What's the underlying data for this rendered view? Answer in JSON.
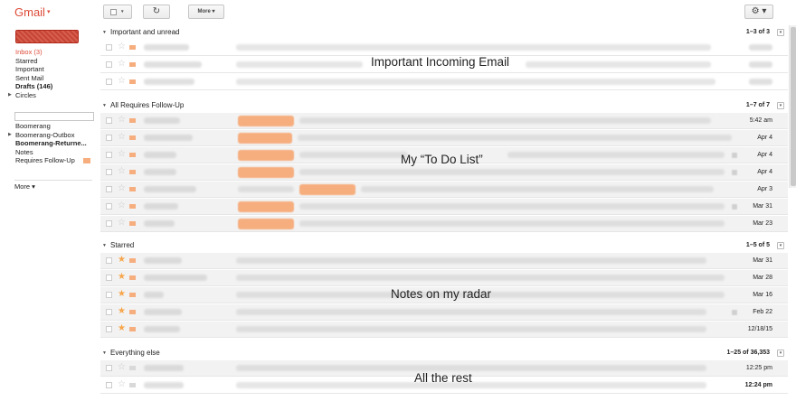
{
  "app": {
    "logo": "Gmail",
    "logo_caret": "▾"
  },
  "sidebar": {
    "items": [
      {
        "label": "Inbox (3)",
        "style": "inbox"
      },
      {
        "label": "Starred",
        "style": ""
      },
      {
        "label": "Important",
        "style": ""
      },
      {
        "label": "Sent Mail",
        "style": ""
      },
      {
        "label": "Drafts (146)",
        "style": "bold"
      },
      {
        "label": "Circles",
        "style": ""
      }
    ],
    "items2": [
      {
        "label": "Boomerang",
        "style": ""
      },
      {
        "label": "Boomerang-Outbox",
        "style": ""
      },
      {
        "label": "Boomerang-Returne...",
        "style": "bold"
      },
      {
        "label": "Notes",
        "style": ""
      },
      {
        "label": "Requires Follow-Up",
        "style": ""
      }
    ],
    "more": "More ▾"
  },
  "toolbar": {
    "more_label": "More ▾",
    "refresh_icon": "↻",
    "gear_icon": "⚙ ▾"
  },
  "sections": [
    {
      "title": "Important and unread",
      "count": "1–3 of 3",
      "annotation": "Important Incoming Email",
      "dates": [
        "",
        "",
        ""
      ]
    },
    {
      "title": "All Requires Follow-Up",
      "count": "1–7 of 7",
      "annotation": "My “To Do List”",
      "dates": [
        "5:42 am",
        "Apr 4",
        "Apr 4",
        "Apr 4",
        "Apr 3",
        "Mar 31",
        "Mar 23"
      ]
    },
    {
      "title": "Starred",
      "count": "1–5 of 5",
      "annotation": "Notes on my radar",
      "dates": [
        "Mar 31",
        "Mar 28",
        "Mar 16",
        "Feb 22",
        "12/18/15"
      ]
    },
    {
      "title": "Everything else",
      "count": "1–25 of 36,353",
      "annotation": "All the rest",
      "dates": [
        "12:25 pm",
        "12:24 pm"
      ]
    }
  ],
  "colors": {
    "brand": "#dd4b39",
    "label_orange": "#f6ae7f",
    "star": "#f7a54a"
  }
}
